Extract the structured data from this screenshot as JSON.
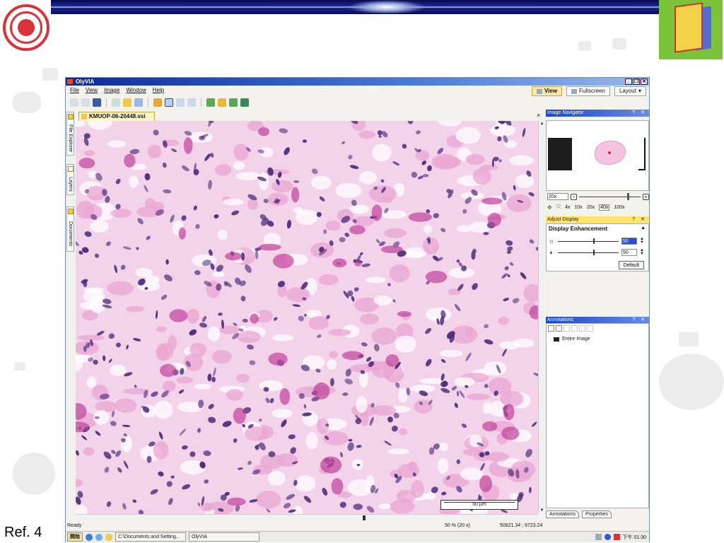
{
  "slide": {
    "ref_label": "Ref. 4"
  },
  "app": {
    "title": "OlyVIA",
    "menu": [
      "File",
      "View",
      "Image",
      "Window",
      "Help"
    ],
    "view_tabs": [
      "View",
      "Fullscreen",
      "Layout"
    ],
    "side_tabs": [
      "File Explorer",
      "Layers",
      "Documents"
    ],
    "document_tab": "KMUOP-06-20448.vsi",
    "scale_bar": "50 µm",
    "status": {
      "ready": "Ready",
      "zoom": "50 % (20 x)",
      "coords": "50621.34 ;  9723.24"
    }
  },
  "image_navigator": {
    "title": "Image Navigator",
    "zoom_value": "20x",
    "magnifications": [
      "4x",
      "10x",
      "20x",
      "40x",
      "100x"
    ]
  },
  "adjust_display": {
    "title": "Adjust Display",
    "section": "Display Enhancement",
    "brightness": "50",
    "contrast": "50",
    "default_button": "Default"
  },
  "annotations": {
    "title": "Annotations",
    "item": "Entire Image",
    "tabs": [
      "Annotations",
      "Properties"
    ]
  },
  "taskbar": {
    "start": "開始",
    "tasks": [
      "C:\\Documents and Setting...",
      "OlyVIA"
    ],
    "clock": "下午 01:30"
  },
  "panel_controls": "? ✕",
  "colors": {
    "tissue_bg": "#f3d3ea",
    "nucleus": "#4a2a78",
    "eosin": "#c0409a",
    "title_blue": "#1a4aca"
  }
}
